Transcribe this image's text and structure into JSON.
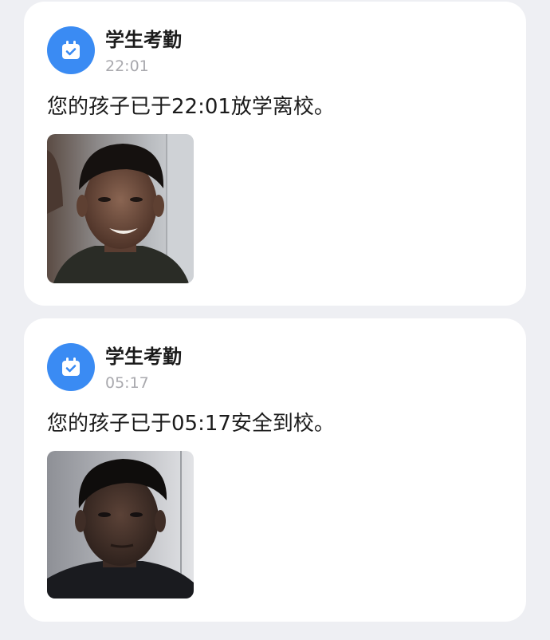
{
  "colors": {
    "background": "#eeeff3",
    "card": "#ffffff",
    "icon_accent": "#3a8bf3",
    "title_text": "#1b1b1b",
    "time_text": "#a9a9ae"
  },
  "messages": [
    {
      "app_name": "学生考勤",
      "icon": "calendar-check-icon",
      "time": "22:01",
      "text": "您的孩子已于22:01放学离校。",
      "photo": "student-face-photo"
    },
    {
      "app_name": "学生考勤",
      "icon": "calendar-check-icon",
      "time": "05:17",
      "text": "您的孩子已于05:17安全到校。",
      "photo": "student-face-photo"
    }
  ]
}
